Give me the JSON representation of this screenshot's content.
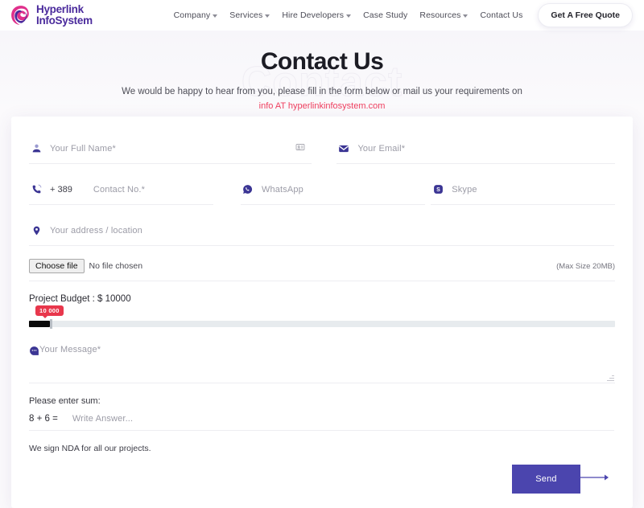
{
  "header": {
    "logo": {
      "line1": "Hyperlink",
      "line2": "InfoSystem",
      "icon": "hyperlink-logo-icon"
    },
    "nav": [
      {
        "label": "Company",
        "has_caret": true
      },
      {
        "label": "Services",
        "has_caret": true
      },
      {
        "label": "Hire Developers",
        "has_caret": true
      },
      {
        "label": "Case Study",
        "has_caret": false
      },
      {
        "label": "Resources",
        "has_caret": true
      },
      {
        "label": "Contact Us",
        "has_caret": false
      }
    ],
    "cta_label": "Get A Free Quote"
  },
  "hero": {
    "watermark": "Contact",
    "title": "Contact Us",
    "subtitle": "We would be happy to hear from you, please fill in the form below or mail us your requirements on",
    "email": "info AT hyperlinkinfosystem.com",
    "email_color": "#ef4060"
  },
  "form": {
    "full_name": {
      "placeholder": "Your Full Name*",
      "value": "",
      "icon": "person-icon",
      "trailing_icon": "contact-card-icon"
    },
    "email": {
      "placeholder": "Your Email*",
      "value": "",
      "icon": "envelope-icon"
    },
    "phone": {
      "prefix": "+ 389",
      "placeholder": "Contact No.*",
      "value": "",
      "icon": "phone-ring-icon"
    },
    "whatsapp": {
      "placeholder": "WhatsApp",
      "value": "",
      "icon": "whatsapp-icon"
    },
    "skype": {
      "placeholder": "Skype",
      "value": "",
      "icon": "skype-icon"
    },
    "address": {
      "placeholder": "Your address / location",
      "value": "",
      "icon": "map-pin-icon"
    },
    "file": {
      "button_label": "Choose file",
      "status": "No file chosen",
      "max_size_note": "(Max Size 20MB)"
    },
    "budget": {
      "label": "Project Budget : $ 10000",
      "bubble_value": "10 000",
      "bubble_color": "#e8374c",
      "fill_color": "#0a0a0a",
      "track_color": "#e7ebee"
    },
    "message": {
      "placeholder": "Your Message*",
      "value": "",
      "icon": "chat-bubble-icon"
    },
    "captcha": {
      "label": "Please enter sum:",
      "question": "8 + 6 =",
      "placeholder": "Write Answer...",
      "value": ""
    },
    "nda_note": "We sign NDA for all our projects.",
    "send": {
      "label": "Send",
      "color": "#4b45ae",
      "arrow_icon": "arrow-right-icon"
    }
  },
  "theme": {
    "accent_indigo": "#4b45ae",
    "logo_purple": "#4a2a9c",
    "logo_pink": "#e0308c",
    "page_bg": "#fbfafc"
  }
}
